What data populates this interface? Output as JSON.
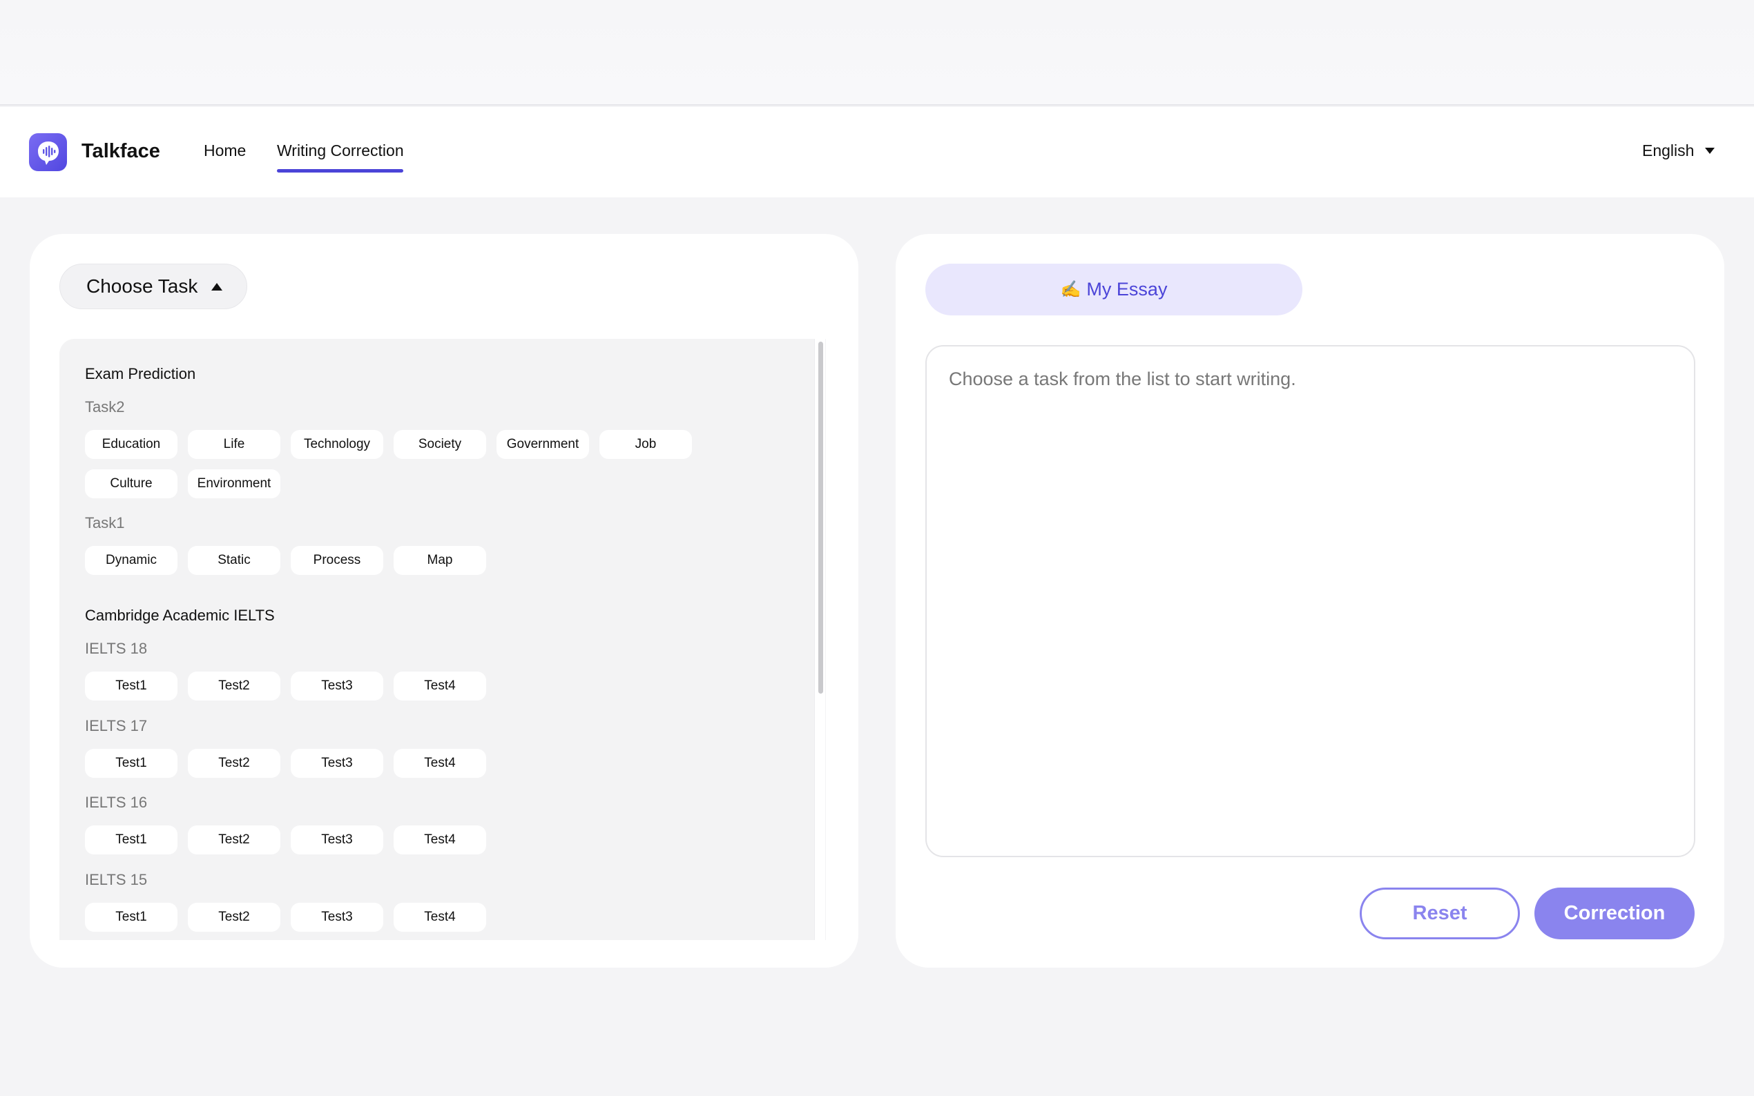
{
  "app": {
    "brand": "Talkface"
  },
  "nav": {
    "items": [
      {
        "label": "Home"
      },
      {
        "label": "Writing Correction"
      }
    ],
    "active": "Writing Correction",
    "language": "English"
  },
  "colors": {
    "accent": "#4b44d8",
    "accent_soft": "#8a84ee",
    "tab_bg": "#e9e7fd"
  },
  "task_panel": {
    "choose_label": "Choose Task",
    "exam_prediction": {
      "title": "Exam Prediction",
      "task2": {
        "label": "Task2",
        "row1": [
          "Education",
          "Life",
          "Technology",
          "Society",
          "Government",
          "Job"
        ],
        "row2": [
          "Culture",
          "Environment"
        ]
      },
      "task1": {
        "label": "Task1",
        "chips": [
          "Dynamic",
          "Static",
          "Process",
          "Map"
        ]
      }
    },
    "cambridge": {
      "title": "Cambridge Academic IELTS",
      "books": [
        {
          "label": "IELTS 18",
          "tests": [
            "Test1",
            "Test2",
            "Test3",
            "Test4"
          ]
        },
        {
          "label": "IELTS 17",
          "tests": [
            "Test1",
            "Test2",
            "Test3",
            "Test4"
          ]
        },
        {
          "label": "IELTS 16",
          "tests": [
            "Test1",
            "Test2",
            "Test3",
            "Test4"
          ]
        },
        {
          "label": "IELTS 15",
          "tests": [
            "Test1",
            "Test2",
            "Test3",
            "Test4"
          ]
        }
      ]
    }
  },
  "essay_panel": {
    "tab_icon": "✍",
    "tab_label": "My Essay",
    "placeholder": "Choose a task from the list to start writing.",
    "reset_label": "Reset",
    "correction_label": "Correction"
  }
}
